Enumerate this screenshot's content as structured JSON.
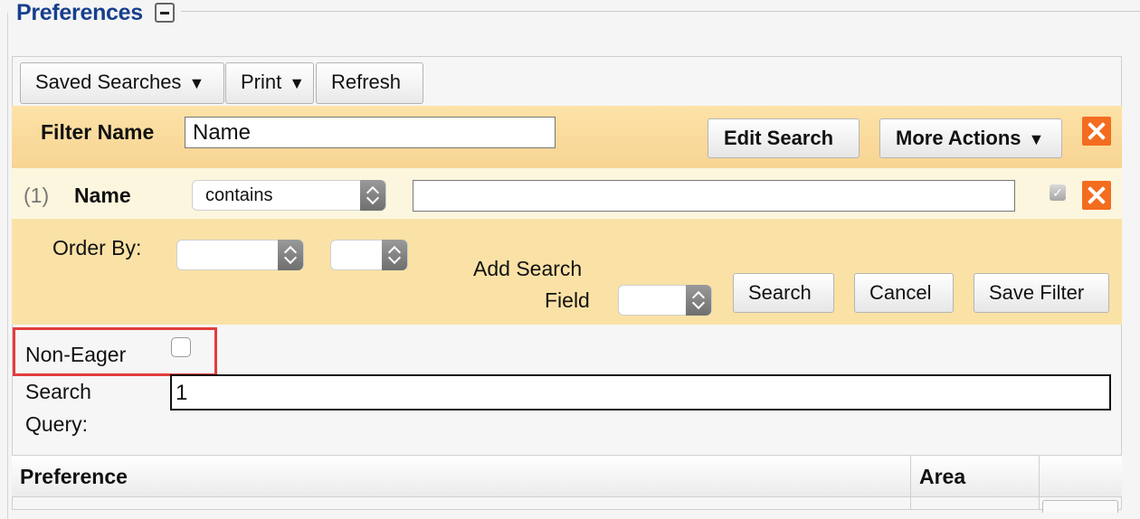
{
  "section": {
    "title": "Preferences"
  },
  "toolbar": {
    "saved_searches": "Saved Searches",
    "print": "Print",
    "refresh": "Refresh",
    "caret": "▼"
  },
  "filter": {
    "label": "Filter Name",
    "value": "Name",
    "edit_search": "Edit Search",
    "more_actions": "More Actions"
  },
  "condition": {
    "index": "(1)",
    "field": "Name",
    "operator": "contains",
    "value": "",
    "checked_mark": "✓"
  },
  "order": {
    "label": "Order By:",
    "field_value": "",
    "direction_value": "",
    "add_field_label_1": "Add Search",
    "add_field_label_2": "Field",
    "add_field_value": ""
  },
  "actions": {
    "search": "Search",
    "cancel": "Cancel",
    "save_filter": "Save Filter"
  },
  "options": {
    "non_eager_label": "Non-Eager",
    "non_eager_checked": false,
    "search_query_label_1": "Search",
    "search_query_label_2": "Query:",
    "search_query_value": "1"
  },
  "table": {
    "columns": [
      "Preference",
      "Area",
      ""
    ]
  },
  "colors": {
    "legend": "#173f8c",
    "highlight": "#e33c3c",
    "delete": "#f36c1f",
    "filter_band": "#fae2a6"
  }
}
